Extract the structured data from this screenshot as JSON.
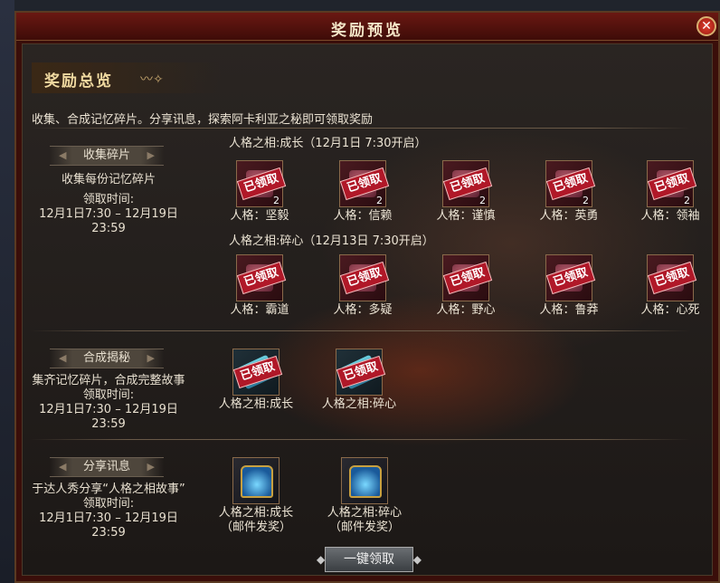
{
  "window": {
    "title": "奖励预览",
    "close_label": "✕"
  },
  "banner": {
    "title": "奖励总览",
    "deco": "〰✧"
  },
  "subtitle": "收集、合成记忆碎片。分享讯息，探索阿卡利亚之秘即可领取奖励",
  "sections": {
    "collect": {
      "label": "收集碎片",
      "desc": "收集每份记忆碎片",
      "time_label": "领取时间:",
      "time_value": "12月1日7:30 – 12月19日23:59",
      "group1_title": "人格之相:成长（12月1日 7:30开启）",
      "group2_title": "人格之相:碎心（12月13日 7:30开启）",
      "group1_items": [
        {
          "name": "人格：坚毅",
          "count": "2",
          "stamp": "已领取"
        },
        {
          "name": "人格：信赖",
          "count": "2",
          "stamp": "已领取"
        },
        {
          "name": "人格：谨慎",
          "count": "2",
          "stamp": "已领取"
        },
        {
          "name": "人格：英勇",
          "count": "2",
          "stamp": "已领取"
        },
        {
          "name": "人格：领袖",
          "count": "2",
          "stamp": "已领取"
        }
      ],
      "group2_items": [
        {
          "name": "人格：霸道",
          "stamp": "已领取"
        },
        {
          "name": "人格：多疑",
          "stamp": "已领取"
        },
        {
          "name": "人格：野心",
          "stamp": "已领取"
        },
        {
          "name": "人格：鲁莽",
          "stamp": "已领取"
        },
        {
          "name": "人格：心死",
          "stamp": "已领取"
        }
      ]
    },
    "compose": {
      "label": "合成揭秘",
      "desc": "集齐记忆碎片，合成完整故事",
      "time_label": "领取时间:",
      "time_value": "12月1日7:30 – 12月19日23:59",
      "items": [
        {
          "name": "人格之相:成长",
          "stamp": "已领取"
        },
        {
          "name": "人格之相:碎心",
          "stamp": "已领取"
        }
      ]
    },
    "share": {
      "label": "分享讯息",
      "desc": "于达人秀分享“人格之相故事”",
      "time_label": "领取时间:",
      "time_value": "12月1日7:30 – 12月19日23:59",
      "items": [
        {
          "name": "人格之相:成长",
          "note": "（邮件发奖）"
        },
        {
          "name": "人格之相:碎心",
          "note": "（邮件发奖）"
        }
      ]
    }
  },
  "claim_all_label": "一键领取"
}
